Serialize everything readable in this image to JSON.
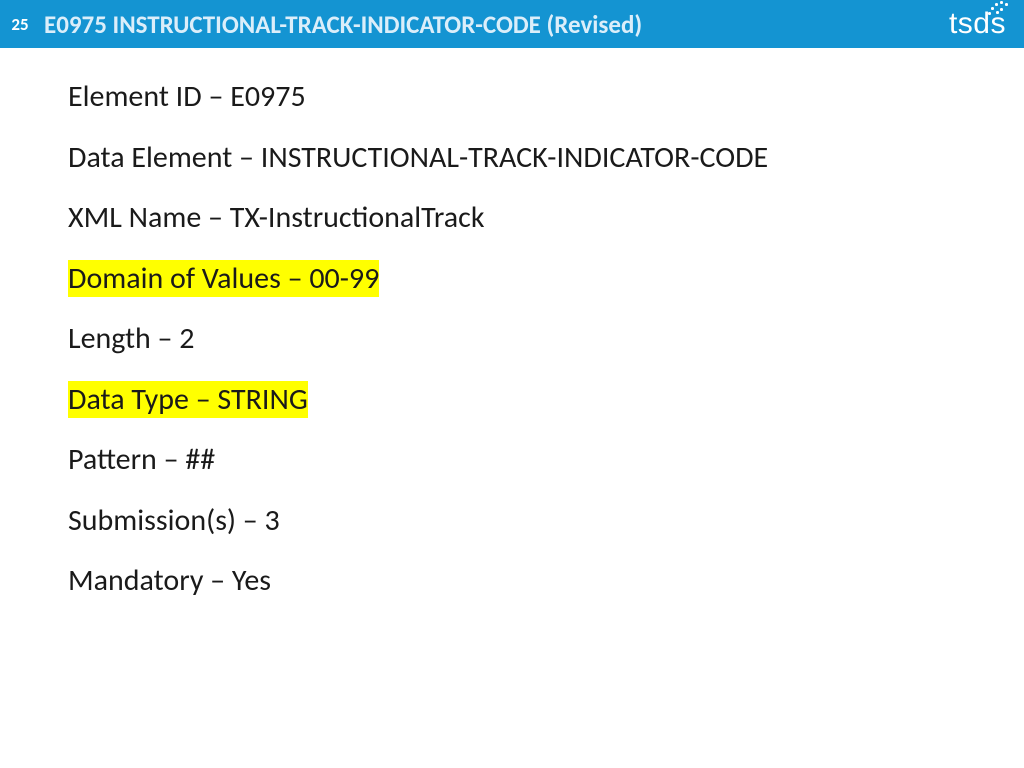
{
  "header": {
    "slideNumber": "25",
    "title": "E0975 INSTRUCTIONAL-TRACK-INDICATOR-CODE (Revised)",
    "logo": "tsds"
  },
  "content": {
    "lines": [
      {
        "text": "Element ID – E0975",
        "highlight": false
      },
      {
        "text": "Data Element – INSTRUCTIONAL-TRACK-INDICATOR-CODE",
        "highlight": false
      },
      {
        "text": "XML Name – TX-InstructionalTrack",
        "highlight": false
      },
      {
        "text": "Domain of Values – 00-99",
        "highlight": true
      },
      {
        "text": "Length – 2",
        "highlight": false
      },
      {
        "text": "Data Type – STRING",
        "highlight": true
      },
      {
        "text": "Pattern – ##",
        "highlight": false
      },
      {
        "text": "Submission(s) – 3",
        "highlight": false
      },
      {
        "text": "Mandatory – Yes",
        "highlight": false
      }
    ]
  }
}
